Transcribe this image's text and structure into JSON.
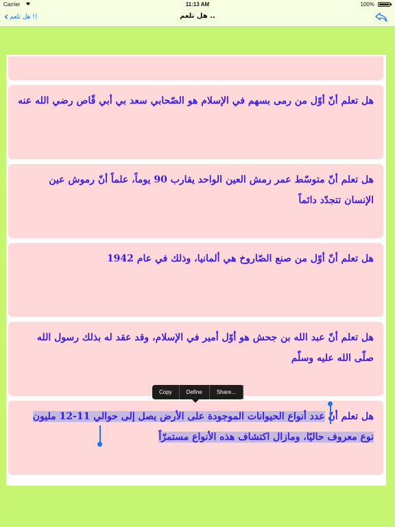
{
  "status": {
    "carrier": "Carrier",
    "time": "11:13 AM",
    "battery": "100%"
  },
  "nav": {
    "back_label": "هل تلعم !!",
    "title": "هل تلعم .."
  },
  "facts": [
    "هل تعلم أنّ أوّل من رمى بسهم في الإسلام هو الصّحابي سعد بي أبي قّاص رضي الله عنه",
    "هل تعلم أنّ متوسّط عمر رمش العين الواحد يقارب 90 يوماً، علماً أنّ رموش عين الإنسان تتجدّد دائماً",
    "هل تعلم أنّ أوّل من صنع الصّاروخ هي ألمانيا، وذلك في عام 1942",
    "هل تعلم أنّ عبد الله بن جحش هو أوّل أمير في الإسلام، وقد عقد له بذلك رسول الله صلّى الله عليه وسلّم"
  ],
  "selected_fact": {
    "prefix": "هل تعلم أنّ ",
    "selected": "عدد أنواع الحيوانات الموجودة على الأرض يصل إلى حوالي 11-12 مليون نوع معروف حاليًا، ومازال اكتشاف هذه الأنواع مستمرّاً"
  },
  "edit_menu": {
    "copy": "Copy",
    "define": "Define",
    "share": "Share..."
  },
  "colors": {
    "background": "#c6f56f",
    "card": "#ffd8d9",
    "text": "#3a1ed8",
    "selection": "#c6b9df",
    "accent": "#1a73e8"
  }
}
